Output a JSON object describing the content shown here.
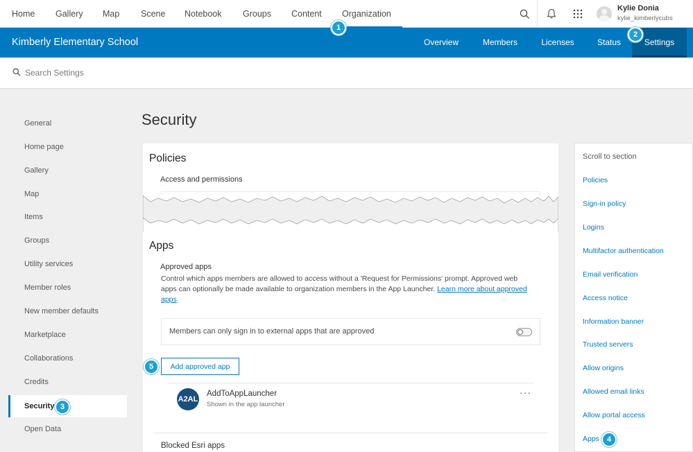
{
  "topnav": {
    "links": [
      "Home",
      "Gallery",
      "Map",
      "Scene",
      "Notebook",
      "Groups",
      "Content",
      "Organization"
    ],
    "active": "Organization"
  },
  "tools": {
    "search": "search-icon",
    "notifications": "bell-icon",
    "apps": "app-launcher-icon"
  },
  "user": {
    "name": "Kylie Donia",
    "username": "kylie_kimberlycubs"
  },
  "banner": {
    "org_name": "Kimberly Elementary School",
    "tabs": [
      "Overview",
      "Members",
      "Licenses",
      "Status",
      "Settings"
    ],
    "active_tab": "Settings"
  },
  "search": {
    "placeholder": "Search Settings"
  },
  "sidebar": {
    "items": [
      "General",
      "Home page",
      "Gallery",
      "Map",
      "Items",
      "Groups",
      "Utility services",
      "Member roles",
      "New member defaults",
      "Marketplace",
      "Collaborations",
      "Credits",
      "Security",
      "Open Data"
    ],
    "active": "Security"
  },
  "main": {
    "title": "Security",
    "policies": {
      "heading": "Policies",
      "subheading": "Access and permissions"
    },
    "apps": {
      "heading": "Apps",
      "approved_heading": "Approved apps",
      "description": "Control which apps members are allowed to access without a 'Request for Permissions' prompt. Approved web apps can optionally be made available to organization members in the App Launcher. ",
      "learn_more": "Learn more about approved apps",
      "toggle_label": "Members can only sign in to external apps that are approved",
      "toggle_on": false,
      "add_button": "Add approved app",
      "approved_list": [
        {
          "logo_text": "A2AL",
          "name": "AddToAppLauncher",
          "subtitle": "Shown in the app launcher",
          "more": "···"
        }
      ],
      "blocked_heading": "Blocked Esri apps"
    }
  },
  "scroll_panel": {
    "heading": "Scroll to section",
    "links": [
      "Policies",
      "Sign-in policy",
      "Logins",
      "Multifactor authentication",
      "Email verification",
      "Access notice",
      "Information banner",
      "Trusted servers",
      "Allow origins",
      "Allowed email links",
      "Allow portal access",
      "Apps"
    ]
  },
  "callouts": [
    "1",
    "2",
    "3",
    "4",
    "5"
  ],
  "colors": {
    "brand_blue": "#0079c1",
    "active_tab": "#005e95",
    "callout": "#1ea0d4"
  }
}
